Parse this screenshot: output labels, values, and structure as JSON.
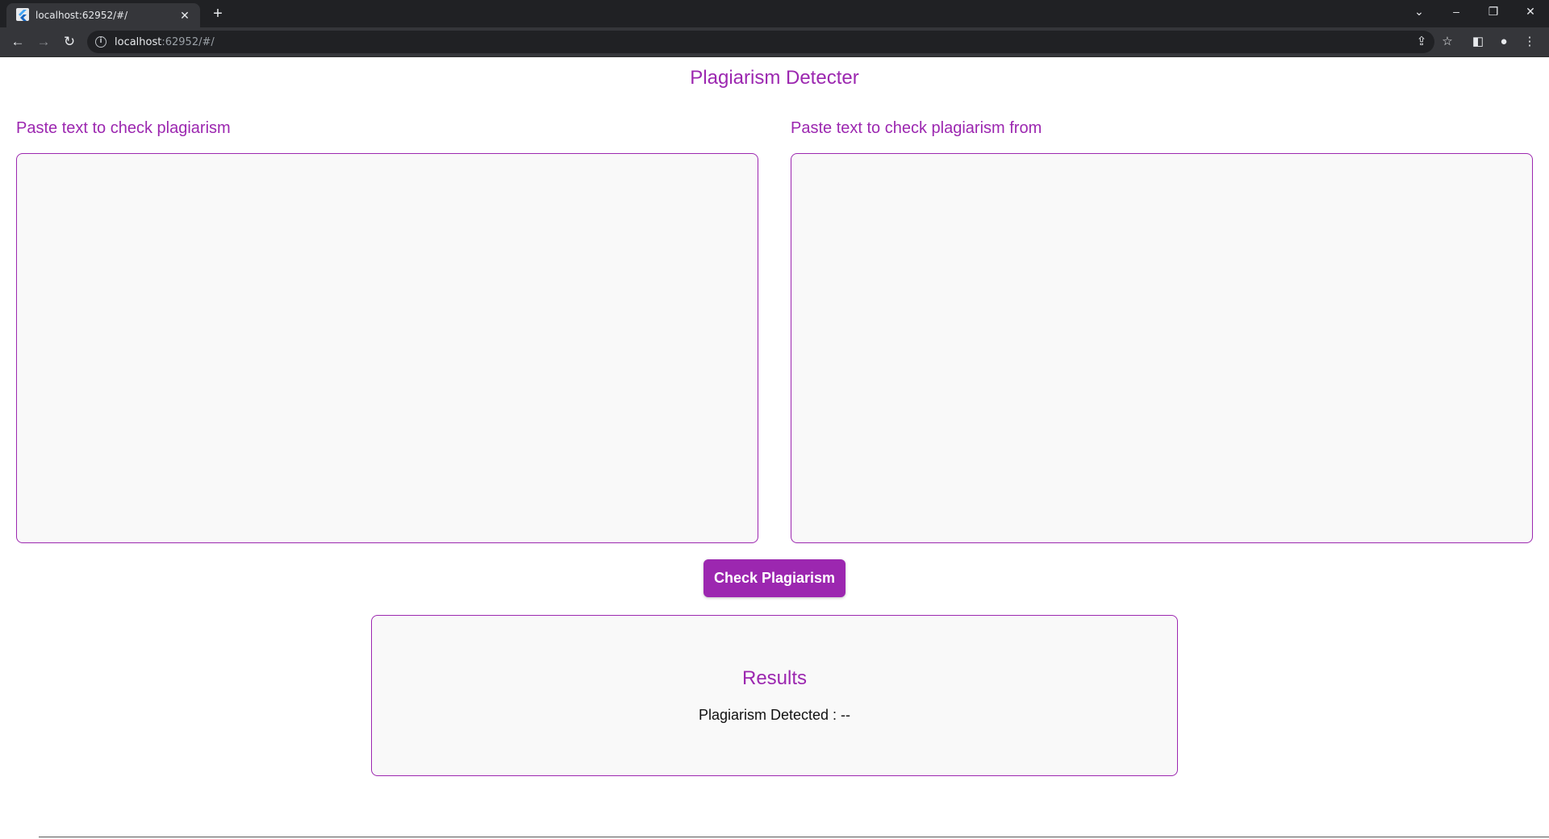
{
  "browser": {
    "tab_title": "localhost:62952/#/",
    "tab_favicon": "flutter-icon",
    "url_host": "localhost",
    "url_rest": ":62952/#/"
  },
  "app": {
    "title": "Plagiarism Detecter",
    "left_label": "Paste text to check plagiarism",
    "right_label": "Paste text to check plagiarism from",
    "left_text": "",
    "right_text": "",
    "check_button": "Check Plagiarism",
    "results_title": "Results",
    "results_line": "Plagiarism Detected : --"
  },
  "colors": {
    "accent": "#9c27b0",
    "field_bg": "#f9f9f9"
  }
}
